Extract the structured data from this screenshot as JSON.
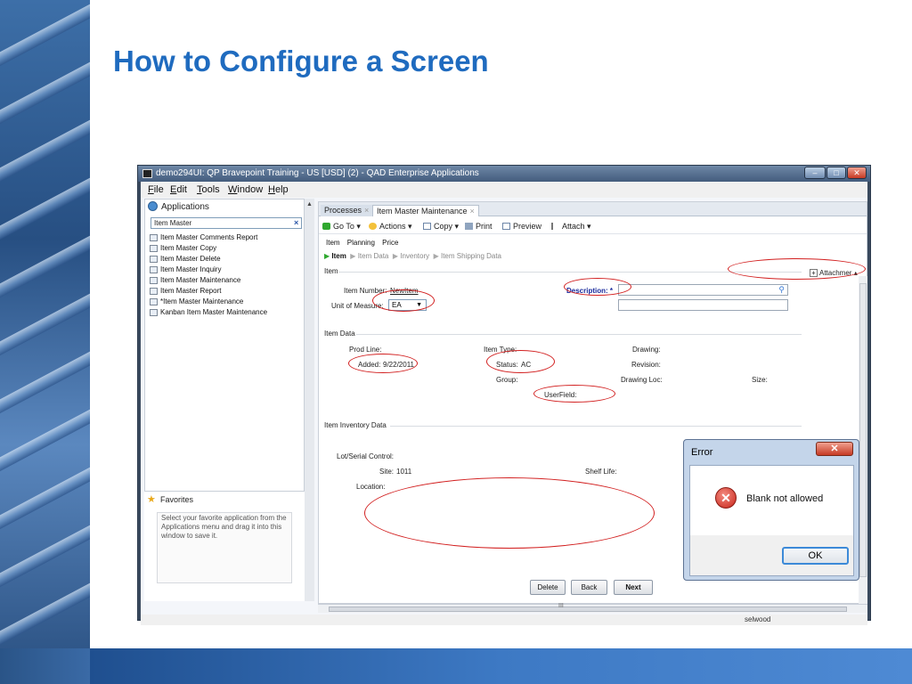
{
  "slide": {
    "title": "How to Configure a Screen"
  },
  "window": {
    "title": "demo294UI: QP Bravepoint Training - US [USD] (2) - QAD Enterprise Applications",
    "controls": {
      "minimize": "–",
      "maximize": "□",
      "close": "✕"
    }
  },
  "menu": [
    "File",
    "Edit",
    "Tools",
    "Window",
    "Help"
  ],
  "applications": {
    "header": "Applications",
    "search_value": "Item Master",
    "search_clear": "×",
    "items": [
      "Item Master Comments Report",
      "Item Master Copy",
      "Item Master Delete",
      "Item Master Inquiry",
      "Item Master Maintenance",
      "Item Master Report",
      "*Item Master Maintenance",
      "Kanban Item Master Maintenance"
    ]
  },
  "favorites": {
    "header": "Favorites",
    "hint": "Select your favorite application from the Applications menu and drag it into this window to save it."
  },
  "tabs": {
    "processes": "Processes",
    "item_master": "Item Master Maintenance",
    "close": "×"
  },
  "toolbar": {
    "goto": "Go To",
    "actions": "Actions",
    "copy": "Copy",
    "print": "Print",
    "preview": "Preview",
    "attach": "Attach"
  },
  "subtabs": [
    "Item",
    "Planning",
    "Price"
  ],
  "breadcrumb": [
    "Item",
    "Item Data",
    "Inventory",
    "Item Shipping Data"
  ],
  "form": {
    "item_section": "Item",
    "attachments": "Attachmer",
    "item_number_label": "Item Number:",
    "item_number_value": "NewItem",
    "uom_label": "Unit of Measure:",
    "uom_value": "EA",
    "description_label": "Description: *",
    "item_data_section": "Item Data",
    "prod_line_label": "Prod Line:",
    "item_type_label": "Item Type:",
    "drawing_label": "Drawing:",
    "added_label": "Added:",
    "added_value": "9/22/2011",
    "status_label": "Status:",
    "status_value": "AC",
    "revision_label": "Revision:",
    "group_label": "Group:",
    "drawing_loc_label": "Drawing Loc:",
    "size_label": "Size:",
    "userfield_label": "UserField:",
    "inventory_section": "Item Inventory Data",
    "lot_serial_label": "Lot/Serial Control:",
    "site_label": "Site:",
    "site_value": "1011",
    "shelf_life_label": "Shelf Life:",
    "location_label": "Location:"
  },
  "buttons": {
    "delete": "Delete",
    "back": "Back",
    "next": "Next"
  },
  "scroll_grip": "III",
  "status": {
    "user": "selwood"
  },
  "error_dialog": {
    "title": "Error",
    "close": "✕",
    "icon": "✕",
    "message": "Blank not allowed",
    "ok": "OK"
  },
  "colors": {
    "title_blue": "#1f6bbf",
    "highlight_red": "#d21f1f",
    "band_blue": "#3d79c4"
  }
}
